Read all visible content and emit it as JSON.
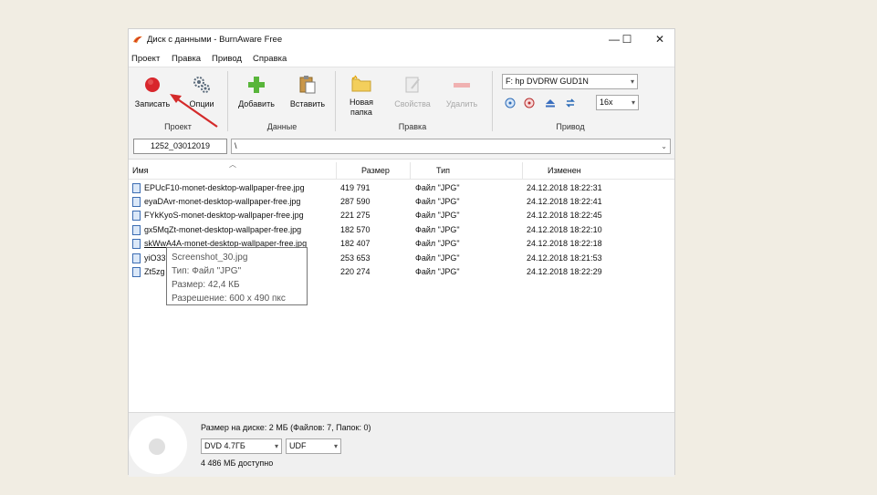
{
  "window": {
    "title": "Диск с данными - BurnAware Free",
    "minimize": "—",
    "maximize": "☐",
    "close": "✕"
  },
  "menu": [
    "Проект",
    "Правка",
    "Привод",
    "Справка"
  ],
  "ribbon": {
    "project": {
      "burn": "Записать",
      "options": "Опции",
      "label": "Проект"
    },
    "data": {
      "add": "Добавить",
      "paste": "Вставить",
      "label": "Данные"
    },
    "edit": {
      "new_folder_line1": "Новая",
      "new_folder_line2": "папка",
      "properties": "Свойства",
      "delete": "Удалить",
      "label": "Правка"
    },
    "drive": {
      "device": "F: hp DVDRW GUD1N",
      "speed": "16x",
      "label": "Привод"
    }
  },
  "address": {
    "volume_name": "1252_03012019",
    "path": "\\"
  },
  "columns": {
    "name": "Имя",
    "size": "Размер",
    "type": "Тип",
    "modified": "Изменен"
  },
  "files": [
    {
      "name": "EPUcF10-monet-desktop-wallpaper-free.jpg",
      "size": "419 791",
      "type": "Файл \"JPG\"",
      "modified": "24.12.2018 18:22:31"
    },
    {
      "name": "eyaDAvr-monet-desktop-wallpaper-free.jpg",
      "size": "287 590",
      "type": "Файл \"JPG\"",
      "modified": "24.12.2018 18:22:41"
    },
    {
      "name": "FYkKyoS-monet-desktop-wallpaper-free.jpg",
      "size": "221 275",
      "type": "Файл \"JPG\"",
      "modified": "24.12.2018 18:22:45"
    },
    {
      "name": "gx5MqZt-monet-desktop-wallpaper-free.jpg",
      "size": "182 570",
      "type": "Файл \"JPG\"",
      "modified": "24.12.2018 18:22:10"
    },
    {
      "name": "skWwA4A-monet-desktop-wallpaper-free.jpg",
      "size": "182 407",
      "type": "Файл \"JPG\"",
      "modified": "24.12.2018 18:22:18"
    },
    {
      "name": "yiO33",
      "size": "253 653",
      "type": "Файл \"JPG\"",
      "modified": "24.12.2018 18:21:53"
    },
    {
      "name": "Zt5zg",
      "size": "220 274",
      "type": "Файл \"JPG\"",
      "modified": "24.12.2018 18:22:29"
    }
  ],
  "tooltip": {
    "line1": "Screenshot_30.jpg",
    "line2": "Тип: Файл \"JPG\"",
    "line3": "Размер: 42,4 КБ",
    "line4": "Разрешение: 600 x 490 пкс"
  },
  "status": {
    "summary": "Размер на диске: 2 МБ (Файлов: 7, Папок: 0)",
    "disc_type": "DVD 4.7ГБ",
    "filesystem": "UDF",
    "free": "4 486 МБ доступно"
  },
  "colors": {
    "burn_red": "#d8262c",
    "annotation_arrow": "#d42a2a",
    "add_green": "#58b53a"
  }
}
